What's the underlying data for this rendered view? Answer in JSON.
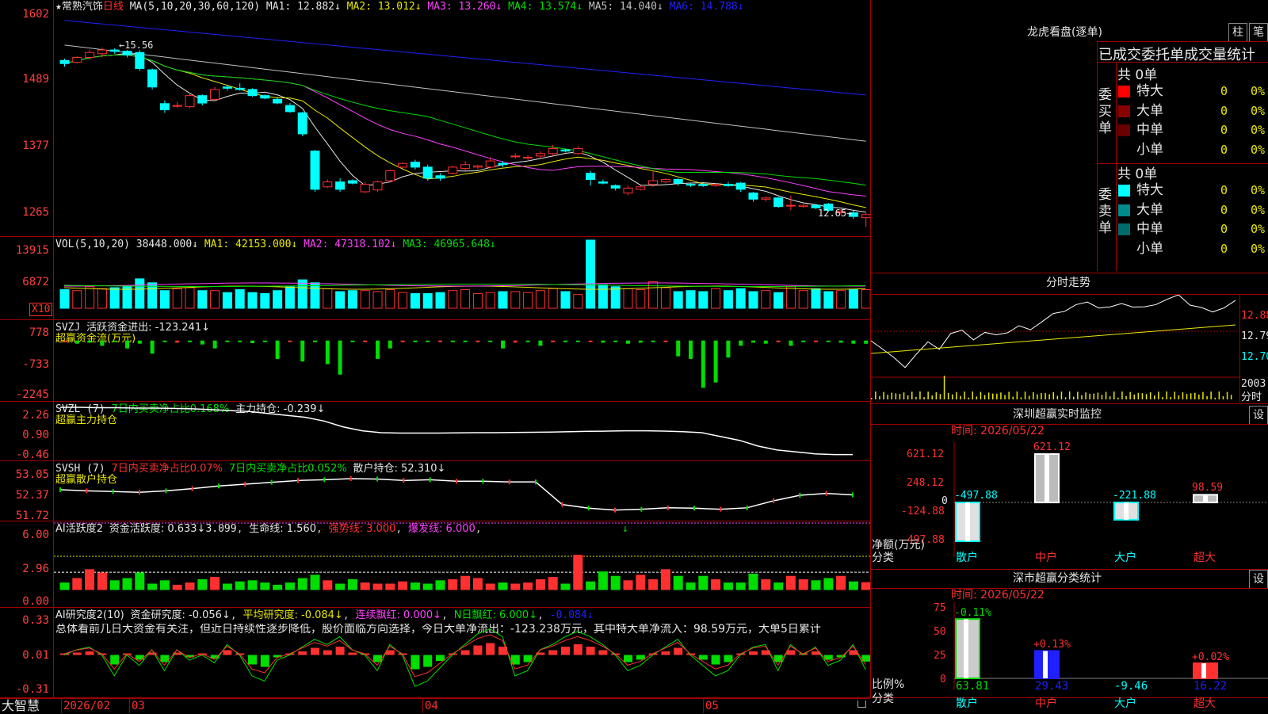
{
  "header": {
    "star": "★",
    "stock_name": "常熟汽饰",
    "period": "日线",
    "ma_params": "MA(5,10,20,30,60,120)",
    "ma1": "MA1: 12.882↓",
    "ma2": "MA2: 13.012↓",
    "ma3": "MA3: 13.260↓",
    "ma4": "MA4: 13.574↓",
    "ma5": "MA5: 14.040↓",
    "ma6": "MA6: 14.788↓"
  },
  "price_axis": [
    "1602",
    "1489",
    "1377",
    "1265"
  ],
  "price_annotations": {
    "high": "15.56",
    "low": "12.65"
  },
  "vol": {
    "label": "VOL(5,10,20)",
    "val": "38448.000↓",
    "ma1": "MA1: 42153.000↓",
    "ma2": "MA2: 47318.102↓",
    "ma3": "MA3: 46965.648↓",
    "axis": [
      "13915",
      "6872"
    ],
    "unit": "X10"
  },
  "svzj": {
    "label": "SVZJ",
    "text": "活跃资金进出: -123.241↓",
    "sub": "超赢资金流(万元)",
    "axis": [
      "778",
      "-733",
      "-2245"
    ]
  },
  "svzl": {
    "label": "SVZL (7)",
    "text1": "7日内买卖净占比0.168%",
    "text2": "主力持仓: -0.239↓",
    "sub": "超赢主力持仓",
    "axis": [
      "2.26",
      "0.90",
      "-0.46"
    ]
  },
  "svsh": {
    "label": "SVSH (7)",
    "text1": "7日内买卖净占比0.07%",
    "text2": "7日内买卖净占比0.052%",
    "text3": "散户持仓: 52.310↓",
    "sub": "超赢散户持仓",
    "axis": [
      "53.05",
      "52.37",
      "51.72"
    ]
  },
  "ai_active": {
    "label": "AI活跃度2",
    "t1": "资金活跃度: 0.633↓",
    "t2": "3.099",
    "t3": "生命线: 1.560",
    "t4": "强势线: 3.000",
    "t5": "爆发线: 6.000",
    "arrow": "↓",
    "axis": [
      "6.00",
      "2.96",
      "0.00"
    ]
  },
  "ai_research": {
    "label": "AI研究度2(10)",
    "t1": "资金研究度: -0.056↓",
    "t2": "平均研究度: -0.084↓",
    "t3": "连续飘红: 0.000↓",
    "t4": "N日飘红: 6.000↓",
    "t5": "-0.084↓",
    "summary": "总体看前几日大资金有关注，但近日持续性逐步降低，股价面临方向选择，今日大单净流出：-123.238万元，其中特大单净流入：98.59万元，大单5日累计",
    "axis": [
      "0.33",
      "0.01",
      "-0.31"
    ]
  },
  "bottom_bar": {
    "brand": "大智慧",
    "dates": [
      "2026/02",
      "03",
      "04",
      "05"
    ]
  },
  "lhb": {
    "title": "龙虎看盘(逐单)",
    "btn_col": "柱",
    "btn_pen": "笔",
    "stats_title": "已成交委托单成交量统计",
    "buy_label": "委买单",
    "sell_label": "委卖单",
    "buy_total": "共 0单",
    "sell_total": "共 0单",
    "buy_rows": [
      {
        "name": "特大",
        "count": "0",
        "pct": "0%",
        "color": "#ff0000"
      },
      {
        "name": "大单",
        "count": "0",
        "pct": "0%",
        "color": "#8b0000"
      },
      {
        "name": "中单",
        "count": "0",
        "pct": "0%",
        "color": "#6b0000"
      },
      {
        "name": "小单",
        "count": "0",
        "pct": "0%",
        "color": "#000000"
      }
    ],
    "sell_rows": [
      {
        "name": "特大",
        "count": "0",
        "pct": "0%",
        "color": "#00ffff"
      },
      {
        "name": "大单",
        "count": "0",
        "pct": "0%",
        "color": "#008b8b"
      },
      {
        "name": "中单",
        "count": "0",
        "pct": "0%",
        "color": "#006b6b"
      },
      {
        "name": "小单",
        "count": "0",
        "pct": "0%",
        "color": "#000000"
      }
    ]
  },
  "intraday": {
    "title": "分时走势",
    "axis": [
      "12.88",
      "12.79",
      "12.70"
    ],
    "vol_label": "2003",
    "time_label": "分时"
  },
  "sz_monitor": {
    "title": "深圳超赢实时监控",
    "btn": "设",
    "time": "时间: 2026/05/22",
    "axis": [
      "621.12",
      "248.12",
      "0",
      "-124.88",
      "-497.88"
    ],
    "ylabel1": "净额(万元)",
    "ylabel2": "分类",
    "categories": [
      "散户",
      "中户",
      "大户",
      "超大"
    ],
    "values": [
      -497.88,
      621.12,
      -221.88,
      98.59
    ],
    "value_labels": [
      "-497.88",
      "621.12",
      "-221.88",
      "98.59"
    ]
  },
  "sz_class": {
    "title": "深市超赢分类统计",
    "btn": "设",
    "time": "时间: 2026/05/22",
    "axis": [
      "75",
      "50",
      "25",
      "0"
    ],
    "ylabel1": "比例%",
    "ylabel2": "分类",
    "categories": [
      "散户",
      "中户",
      "大户",
      "超大"
    ],
    "values": [
      63.81,
      29.43,
      -9.46,
      16.22
    ],
    "value_labels": [
      "63.81",
      "29.43",
      "-9.46",
      "16.22"
    ],
    "changes": [
      "-0.11%",
      "+0.13%",
      "",
      "+0.02%"
    ]
  },
  "chart_data": [
    {
      "type": "candlestick",
      "title": "常熟汽饰 日线",
      "ylim": [
        12.5,
        16.1
      ],
      "x_ticks": [
        "2026/02",
        "03",
        "04",
        "05"
      ],
      "ohlc": [
        [
          15.35,
          15.38,
          15.25,
          15.3
        ],
        [
          15.32,
          15.42,
          15.3,
          15.4
        ],
        [
          15.4,
          15.52,
          15.36,
          15.48
        ],
        [
          15.46,
          15.56,
          15.4,
          15.52
        ],
        [
          15.52,
          15.55,
          15.46,
          15.5
        ],
        [
          15.5,
          15.52,
          15.4,
          15.44
        ],
        [
          15.48,
          15.52,
          15.18,
          15.22
        ],
        [
          15.2,
          15.22,
          14.88,
          14.92
        ],
        [
          14.65,
          14.7,
          14.5,
          14.55
        ],
        [
          14.62,
          14.68,
          14.58,
          14.62
        ],
        [
          14.6,
          14.82,
          14.58,
          14.78
        ],
        [
          14.78,
          14.8,
          14.62,
          14.66
        ],
        [
          14.72,
          14.92,
          14.7,
          14.88
        ],
        [
          14.92,
          14.96,
          14.86,
          14.9
        ],
        [
          14.9,
          14.98,
          14.86,
          14.88
        ],
        [
          14.88,
          14.9,
          14.76,
          14.78
        ],
        [
          14.78,
          14.8,
          14.72,
          14.74
        ],
        [
          14.72,
          14.76,
          14.64,
          14.66
        ],
        [
          14.62,
          14.66,
          14.5,
          14.52
        ],
        [
          14.5,
          14.52,
          14.12,
          14.16
        ],
        [
          13.88,
          13.9,
          13.22,
          13.26
        ],
        [
          13.3,
          13.42,
          13.28,
          13.38
        ],
        [
          13.38,
          13.44,
          13.22,
          13.26
        ],
        [
          13.4,
          13.42,
          13.34,
          13.36
        ],
        [
          13.22,
          13.38,
          13.2,
          13.34
        ],
        [
          13.25,
          13.4,
          13.22,
          13.38
        ],
        [
          13.4,
          13.58,
          13.38,
          13.56
        ],
        [
          13.62,
          13.7,
          13.6,
          13.68
        ],
        [
          13.7,
          13.74,
          13.58,
          13.62
        ],
        [
          13.62,
          13.66,
          13.4,
          13.44
        ],
        [
          13.48,
          13.52,
          13.4,
          13.44
        ],
        [
          13.52,
          13.64,
          13.5,
          13.62
        ],
        [
          13.6,
          13.72,
          13.56,
          13.66
        ],
        [
          13.62,
          13.66,
          13.58,
          13.64
        ],
        [
          13.62,
          13.78,
          13.6,
          13.72
        ],
        [
          13.68,
          13.72,
          13.62,
          13.66
        ],
        [
          13.8,
          13.84,
          13.76,
          13.8
        ],
        [
          13.78,
          13.82,
          13.74,
          13.78
        ],
        [
          13.8,
          13.88,
          13.76,
          13.84
        ],
        [
          13.84,
          13.98,
          13.8,
          13.92
        ],
        [
          13.9,
          13.92,
          13.86,
          13.88
        ],
        [
          13.84,
          13.96,
          13.82,
          13.92
        ],
        [
          13.52,
          13.56,
          13.32,
          13.42
        ],
        [
          13.38,
          13.42,
          13.34,
          13.36
        ],
        [
          13.32,
          13.34,
          13.24,
          13.28
        ],
        [
          13.2,
          13.32,
          13.16,
          13.28
        ],
        [
          13.26,
          13.32,
          13.24,
          13.3
        ],
        [
          13.34,
          13.56,
          13.3,
          13.4
        ],
        [
          13.38,
          13.44,
          13.36,
          13.42
        ],
        [
          13.42,
          13.44,
          13.32,
          13.36
        ],
        [
          13.34,
          13.36,
          13.3,
          13.33
        ],
        [
          13.34,
          13.36,
          13.3,
          13.32
        ],
        [
          13.32,
          13.36,
          13.3,
          13.34
        ],
        [
          13.34,
          13.38,
          13.3,
          13.32
        ],
        [
          13.36,
          13.38,
          13.22,
          13.26
        ],
        [
          13.2,
          13.22,
          13.06,
          13.1
        ],
        [
          13.1,
          13.14,
          13.06,
          13.12
        ],
        [
          13.12,
          13.14,
          12.96,
          12.98
        ],
        [
          13.0,
          13.16,
          12.92,
          13.0
        ],
        [
          12.98,
          13.02,
          12.96,
          13.0
        ],
        [
          13.0,
          13.02,
          12.94,
          12.96
        ],
        [
          13.02,
          13.04,
          12.9,
          12.92
        ],
        [
          12.88,
          12.94,
          12.84,
          12.9
        ],
        [
          12.88,
          12.92,
          12.78,
          12.82
        ],
        [
          12.8,
          12.88,
          12.65,
          12.85
        ]
      ],
      "ma_lines": [
        "MA1",
        "MA2",
        "MA3",
        "MA4",
        "MA5",
        "MA6"
      ]
    },
    {
      "type": "bar",
      "title": "VOL(5,10,20)",
      "values": [
        38,
        36,
        44,
        40,
        42,
        44,
        60,
        52,
        36,
        40,
        42,
        36,
        36,
        32,
        38,
        32,
        30,
        36,
        44,
        58,
        52,
        40,
        34,
        36,
        36,
        34,
        38,
        32,
        30,
        30,
        32,
        36,
        38,
        30,
        32,
        34,
        34,
        32,
        36,
        40,
        34,
        28,
        62,
        48,
        44,
        40,
        38,
        54,
        42,
        34,
        36,
        34,
        40,
        36,
        40,
        34,
        36,
        32,
        44,
        36,
        40,
        34,
        36,
        38,
        38
      ],
      "special": [
        {
          "index": 42,
          "value": 139
        }
      ]
    },
    {
      "type": "bar",
      "title": "SVZJ 超赢资金流(万元)",
      "ylim": [
        -2245,
        778
      ],
      "values": [
        -50,
        -120,
        -80,
        -200,
        -60,
        -300,
        -120,
        -500,
        -50,
        -80,
        -60,
        -150,
        -300,
        -40,
        -30,
        -100,
        -30,
        -700,
        -50,
        -800,
        -50,
        -900,
        -1300,
        -50,
        -40,
        -700,
        -300,
        -60,
        -50,
        -40,
        -60,
        -30,
        -50,
        -60,
        -40,
        -300,
        -80,
        -40,
        -200,
        -60,
        -40,
        -60,
        -50,
        -80,
        -50,
        -120,
        -80,
        -40,
        -50,
        -600,
        -700,
        -1800,
        -1600,
        -650,
        -200,
        -80,
        -120,
        -60,
        -200,
        -50,
        -30,
        -60,
        -80,
        -120,
        -123
      ]
    },
    {
      "type": "line",
      "title": "SVZL 主力持仓",
      "ylim": [
        -0.46,
        2.26
      ],
      "values": [
        2.22,
        2.22,
        2.2,
        2.2,
        2.18,
        2.18,
        2.16,
        2.14,
        2.1,
        2.05,
        2.0,
        1.9,
        1.8,
        1.7,
        1.5,
        1.2,
        1.0,
        0.9,
        0.88,
        0.88,
        0.88,
        0.89,
        0.9,
        0.9,
        0.91,
        0.92,
        0.93,
        0.95,
        0.97,
        0.98,
        1.0,
        1.0,
        0.98,
        0.95,
        0.9,
        0.7,
        0.5,
        0.2,
        0.0,
        -0.1,
        -0.2,
        -0.24,
        -0.239
      ]
    },
    {
      "type": "line",
      "title": "SVSH 散户持仓",
      "ylim": [
        51.72,
        53.05
      ],
      "values": [
        52.45,
        52.42,
        52.4,
        52.38,
        52.42,
        52.48,
        52.55,
        52.6,
        52.65,
        52.7,
        52.72,
        52.75,
        52.74,
        52.7,
        52.72,
        52.68,
        52.68,
        52.66,
        52.66,
        52.05,
        51.95,
        51.9,
        51.92,
        51.96,
        51.95,
        51.92,
        51.96,
        52.15,
        52.3,
        52.35,
        52.31
      ]
    },
    {
      "type": "bar",
      "title": "AI活跃度2 资金活跃度",
      "ylim": [
        0,
        6
      ],
      "values": [
        0.6,
        1.0,
        1.8,
        1.5,
        0.8,
        1.0,
        1.5,
        0.5,
        0.8,
        0.4,
        0.6,
        0.9,
        1.1,
        0.5,
        0.7,
        0.8,
        0.6,
        0.4,
        0.6,
        1.0,
        1.3,
        0.8,
        0.5,
        0.9,
        0.6,
        0.5,
        0.5,
        0.7,
        0.6,
        0.5,
        0.8,
        0.9,
        1.2,
        1.0,
        0.5,
        0.6,
        0.5,
        0.6,
        0.9,
        1.1,
        0.5,
        3.1,
        0.7,
        1.6,
        1.2,
        0.8,
        1.3,
        0.9,
        1.8,
        1.2,
        0.6,
        1.2,
        0.9,
        0.6,
        0.6,
        1.4,
        0.9,
        0.6,
        1.2,
        0.9,
        0.8,
        1.0,
        1.2,
        0.7,
        0.63
      ],
      "lines": {
        "生命线": 1.56,
        "强势线": 3.0,
        "爆发线": 6.0
      }
    },
    {
      "type": "bar",
      "title": "AI研究度2(10) 资金研究度",
      "ylim": [
        -0.31,
        0.33
      ],
      "values": [
        0.0,
        0.02,
        0.03,
        0.0,
        -0.08,
        0.0,
        -0.04,
        0.02,
        -0.06,
        0.02,
        -0.02,
        0.0,
        -0.03,
        0.04,
        0.0,
        -0.08,
        -0.1,
        -0.02,
        0.0,
        0.03,
        0.06,
        0.04,
        0.07,
        0.02,
        0.0,
        -0.06,
        0.04,
        0.0,
        -0.12,
        -0.1,
        -0.05,
        0.0,
        0.04,
        0.08,
        0.1,
        0.07,
        -0.08,
        -0.06,
        0.02,
        0.04,
        0.07,
        0.09,
        0.07,
        0.04,
        0.0,
        -0.06,
        -0.04,
        0.0,
        0.03,
        0.06,
        0.0,
        -0.04,
        -0.08,
        -0.06,
        0.0,
        0.03,
        0.04,
        -0.06,
        0.04,
        0.0,
        0.03,
        -0.04,
        -0.02,
        0.04,
        -0.056
      ],
      "avg_line": -0.084
    },
    {
      "type": "line",
      "title": "分时走势",
      "ylim": [
        12.66,
        12.9
      ],
      "values": [
        12.76,
        12.74,
        12.7,
        12.68,
        12.72,
        12.75,
        12.74,
        12.78,
        12.79,
        12.77,
        12.78,
        12.78,
        12.79,
        12.8,
        12.8,
        12.82,
        12.84,
        12.86,
        12.87,
        12.88,
        12.87,
        12.86,
        12.88,
        12.87,
        12.86,
        12.88,
        12.89,
        12.9,
        12.88,
        12.86,
        12.85,
        12.87,
        12.88
      ]
    },
    {
      "type": "bar",
      "title": "深圳超赢实时监控",
      "categories": [
        "散户",
        "中户",
        "大户",
        "超大"
      ],
      "values": [
        -497.88,
        621.12,
        -221.88,
        98.59
      ],
      "ylim": [
        -497.88,
        621.12
      ],
      "ylabel": "净额(万元)",
      "xlabel": "分类"
    },
    {
      "type": "bar",
      "title": "深市超赢分类统计",
      "categories": [
        "散户",
        "中户",
        "大户",
        "超大"
      ],
      "values": [
        63.81,
        29.43,
        -9.46,
        16.22
      ],
      "ylim": [
        0,
        75
      ],
      "ylabel": "比例%",
      "xlabel": "分类"
    }
  ]
}
